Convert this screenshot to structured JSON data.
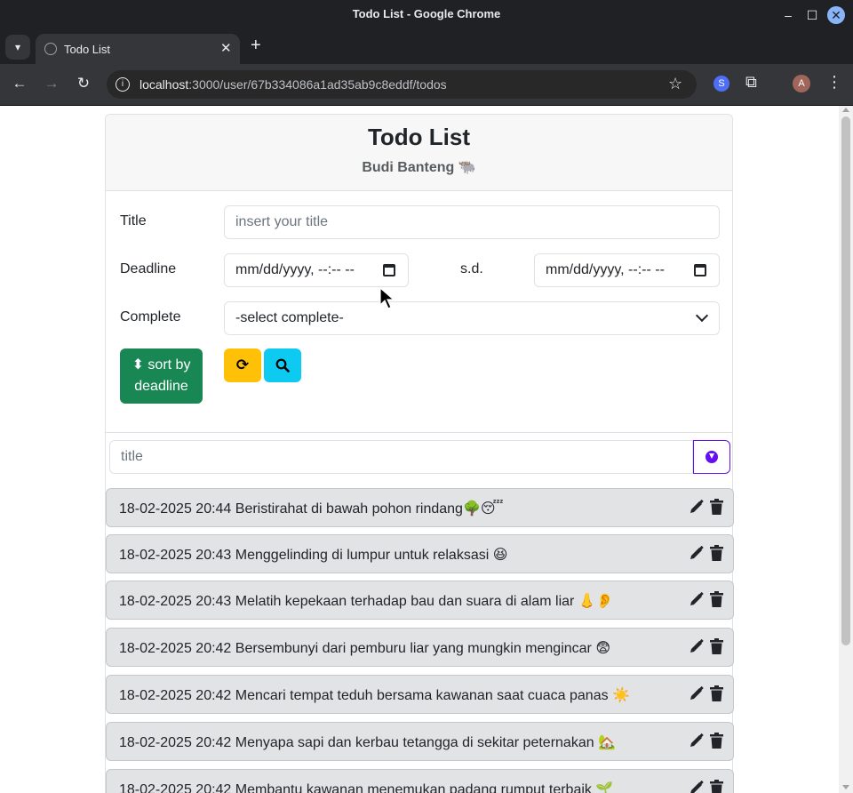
{
  "window": {
    "title": "Todo List - Google Chrome"
  },
  "tab": {
    "title": "Todo List",
    "close": "✕",
    "new_tab": "+"
  },
  "toolbar": {
    "url_host": "localhost",
    "url_rest": ":3000/user/67b334086a1ad35ab9c8eddf/todos",
    "avatar_letter": "A"
  },
  "header": {
    "title": "Todo List",
    "subtitle": "Budi Banteng 🐃"
  },
  "filters": {
    "title_label": "Title",
    "title_placeholder": "insert your title",
    "deadline_label": "Deadline",
    "deadline_from": "mm/dd/yyyy, --:-- --",
    "range_sep": "s.d.",
    "deadline_to": "mm/dd/yyyy, --:-- --",
    "complete_label": "Complete",
    "complete_selected": "-select complete-",
    "sort_button_line1": "sort by",
    "sort_button_line2": "deadline"
  },
  "add": {
    "placeholder": "title"
  },
  "todos": [
    {
      "date": "18-02-2025 20:44",
      "title": "Beristirahat di bawah pohon rindang🌳😴"
    },
    {
      "date": "18-02-2025 20:43",
      "title": "Menggelinding di lumpur untuk relaksasi 😆"
    },
    {
      "date": "18-02-2025 20:43",
      "title": "Melatih kepekaan terhadap bau dan suara di alam liar 👃👂"
    },
    {
      "date": "18-02-2025 20:42",
      "title": "Bersembunyi dari pemburu liar yang mungkin mengincar 😨"
    },
    {
      "date": "18-02-2025 20:42",
      "title": "Mencari tempat teduh bersama kawanan saat cuaca panas ☀️"
    },
    {
      "date": "18-02-2025 20:42",
      "title": "Menyapa sapi dan kerbau tetangga di sekitar peternakan 🏡"
    },
    {
      "date": "18-02-2025 20:42",
      "title": "Membantu kawanan menemukan padang rumput terbaik 🌱"
    }
  ],
  "colors": {
    "sort_button": "#198754",
    "reset_button": "#ffc107",
    "search_button": "#0dcaf0",
    "add_button_border": "#6610f2",
    "todo_item_bg": "#e2e3e5"
  }
}
